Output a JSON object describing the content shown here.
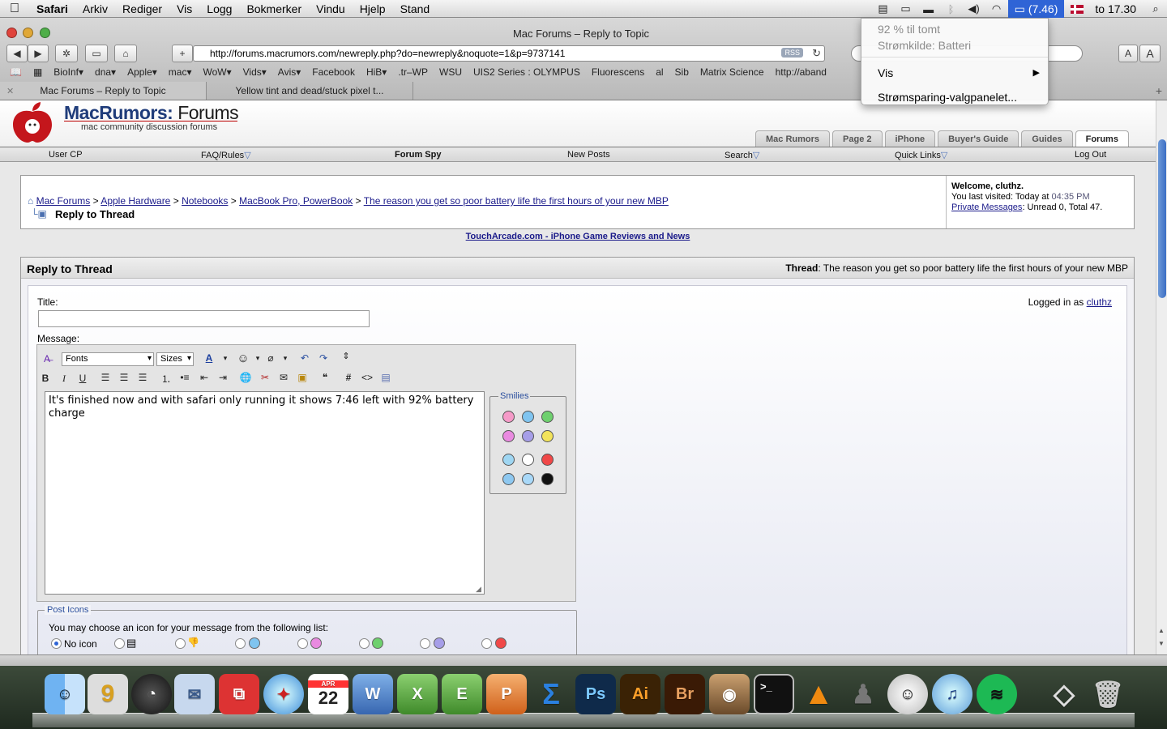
{
  "menubar": {
    "app": "Safari",
    "items": [
      "Arkiv",
      "Rediger",
      "Vis",
      "Logg",
      "Bokmerker",
      "Vindu",
      "Hjelp",
      "Stand"
    ],
    "battery": "(7.46)",
    "clock": "to 17.30"
  },
  "battery_menu": {
    "remaining": "92 % til tomt",
    "source": "Strømkilde: Batteri",
    "show": "Vis",
    "prefs": "Strømsparing-valgpanelet..."
  },
  "window": {
    "title": "Mac Forums – Reply to Topic",
    "url": "http://forums.macrumors.com/newreply.php?do=newreply&noquote=1&p=9737141",
    "rss": "RSS"
  },
  "bookmarks": [
    "BioInf▾",
    "dna▾",
    "Apple▾",
    "mac▾",
    "WoW▾",
    "Vids▾",
    "Avis▾",
    "Facebook",
    "HiB▾",
    ".tr–WP",
    "WSU",
    "UIS2 Series : OLYMPUS",
    "Fluorescens",
    "al",
    "Sib",
    "Matrix Science",
    "http://aband"
  ],
  "tabs": [
    "Mac Forums – Reply to Topic",
    "Yellow tint and dead/stuck pixel t..."
  ],
  "site": {
    "logo_main": "MacRumors:",
    "logo_forums": "Forums",
    "logo_sub": "mac community discussion forums",
    "tabs": [
      "Mac Rumors",
      "Page 2",
      "iPhone",
      "Buyer's Guide",
      "Guides",
      "Forums"
    ],
    "nav": {
      "user_cp": "User CP",
      "faq": "FAQ/Rules",
      "forum_spy": "Forum Spy",
      "new_posts": "New Posts",
      "search": "Search",
      "quick_links": "Quick Links",
      "log_out": "Log Out"
    }
  },
  "breadcrumb": {
    "items": [
      "Mac Forums",
      "Apple Hardware",
      "Notebooks",
      "MacBook Pro, PowerBook",
      "The reason you get so poor battery life the first hours of your new MBP"
    ],
    "separator": ">",
    "current": "Reply to Thread"
  },
  "welcome": {
    "greeting": "Welcome, cluthz.",
    "last_visited_label": "You last visited: Today at",
    "last_visited_time": "04:35 PM",
    "pm_link": "Private Messages",
    "pm_status": ": Unread 0, Total 47."
  },
  "ad_link": "TouchArcade.com - iPhone Game Reviews and News",
  "reply": {
    "heading": "Reply to Thread",
    "thread_label": "Thread",
    "thread_title": ": The reason you get so poor battery life the first hours of your new MBP",
    "title_label": "Title:",
    "title_value": "",
    "logged_in_label": "Logged in as",
    "username": "cluthz",
    "message_label": "Message:",
    "fonts": "Fonts",
    "sizes": "Sizes",
    "message": "It's finished now and with safari only running it shows 7:46 left with 92% battery charge",
    "smilies_label": "Smilies",
    "post_icons_label": "Post Icons",
    "post_icons_desc": "You may choose an icon for your message from the following list:",
    "no_icon": "No icon"
  },
  "dock": {
    "photoshop": "Ps",
    "illustrator": "Ai",
    "bridge": "Br",
    "calendar_month": "APR",
    "calendar_day": "22"
  }
}
